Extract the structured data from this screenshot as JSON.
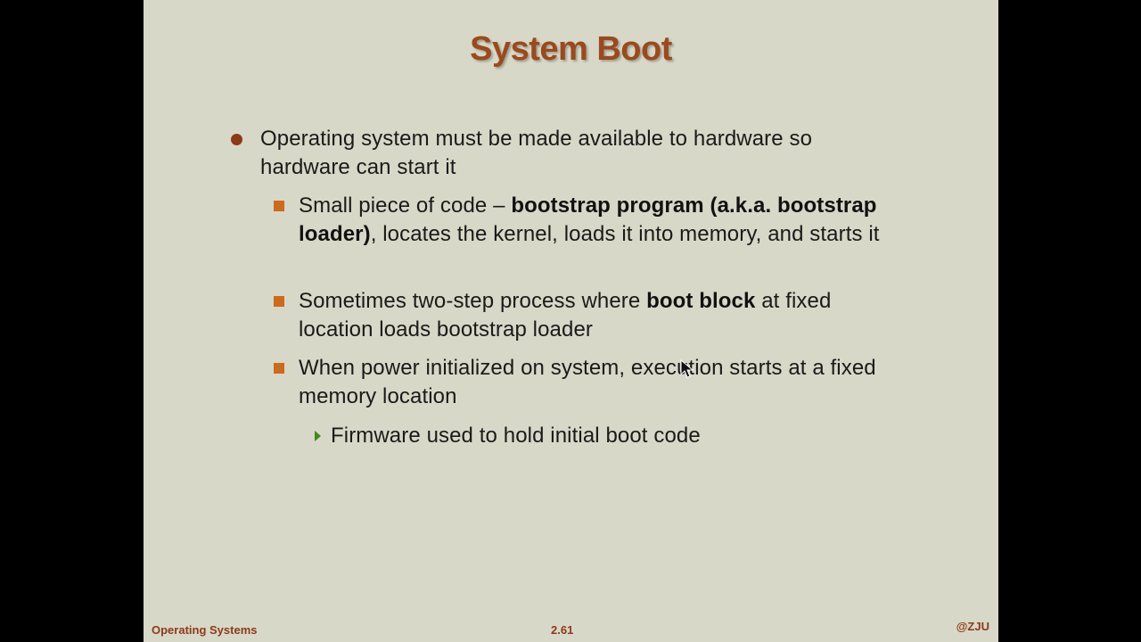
{
  "slide": {
    "title": "System Boot",
    "bullets": {
      "l1_text": "Operating system must be made available to hardware so hardware can start it",
      "l2a_pre": "Small piece of code – ",
      "l2a_bold": "bootstrap program (a.k.a. bootstrap loader)",
      "l2a_post": ", locates the kernel, loads it into memory, and starts it",
      "l2b_pre": "Sometimes two-step process where ",
      "l2b_bold": "boot block",
      "l2b_post": " at fixed location loads bootstrap loader",
      "l2c_text": "When power initialized on system, execution starts at a fixed memory location",
      "l3_text": "Firmware used to hold initial boot code"
    },
    "footer": {
      "left": "Operating Systems",
      "center": "2.61",
      "right": "@ZJU"
    }
  },
  "colors": {
    "background": "#d8d8c8",
    "title": "#9a4a1e",
    "l1_bullet": "#8c3a1a",
    "l2_bullet": "#cc6a1e",
    "l3_bullet": "#3e8a1e",
    "footer": "#8c3a1a"
  },
  "icons": {
    "cursor": "mouse-pointer-icon"
  }
}
